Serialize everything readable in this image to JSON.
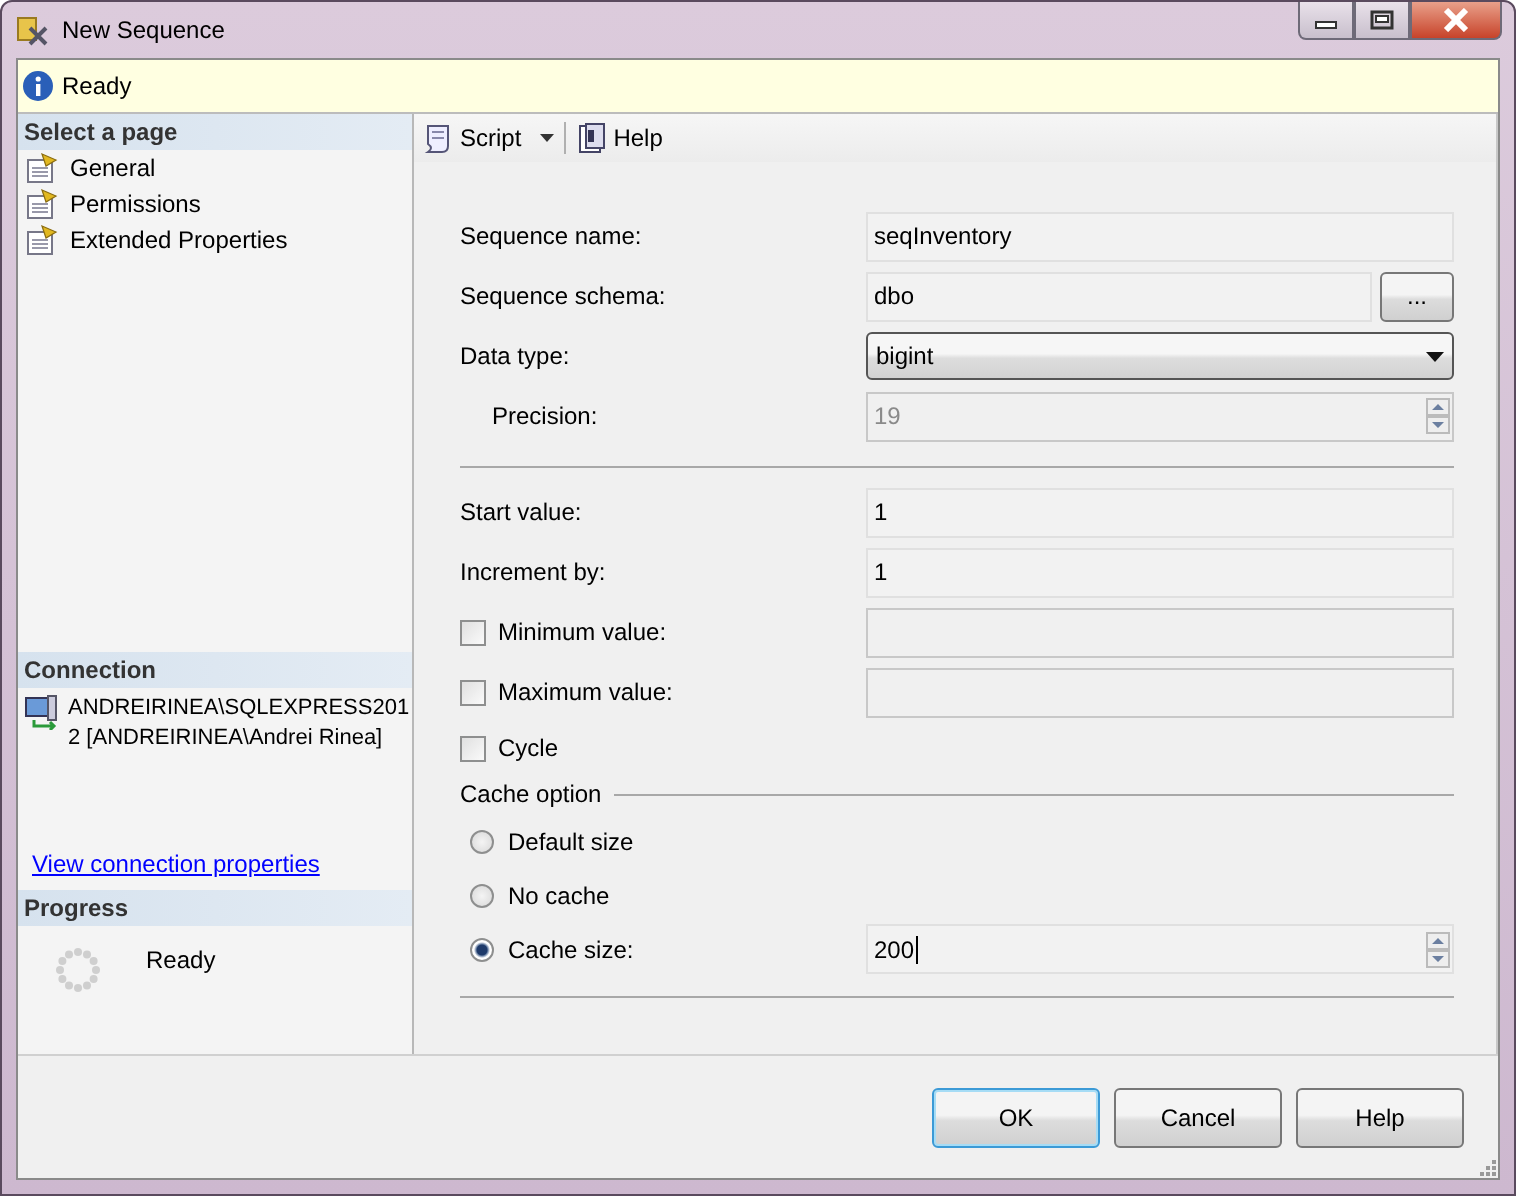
{
  "window": {
    "title": "New Sequence"
  },
  "info_bar": {
    "text": "Ready"
  },
  "sidebar": {
    "header": "Select a page",
    "items": [
      {
        "label": "General"
      },
      {
        "label": "Permissions"
      },
      {
        "label": "Extended Properties"
      }
    ]
  },
  "connection": {
    "header": "Connection",
    "server": "ANDREIRINEA\\SQLEXPRESS2012 [ANDREIRINEA\\Andrei Rinea]",
    "link": "View connection properties"
  },
  "progress": {
    "header": "Progress",
    "status": "Ready"
  },
  "toolbar": [
    {
      "kind": "dropdown",
      "label": "Script"
    },
    {
      "kind": "button",
      "label": "Help"
    }
  ],
  "general": [
    {
      "kind": "text",
      "label": "Sequence name:",
      "value": "seqInventory"
    },
    {
      "kind": "browse",
      "label": "Sequence schema:",
      "value": "dbo",
      "button": "..."
    },
    {
      "kind": "dropdown",
      "label": "Data type:",
      "value": "bigint"
    },
    {
      "kind": "sub_spinner",
      "label": "Precision:",
      "value": "19",
      "disabled": true
    }
  ],
  "values": [
    {
      "kind": "text",
      "label": "Start value:",
      "value": "1"
    },
    {
      "kind": "text",
      "label": "Increment by:",
      "value": "1"
    },
    {
      "kind": "checkbox_field",
      "label": "Minimum value:",
      "checked": false
    },
    {
      "kind": "checkbox_field",
      "label": "Maximum value:",
      "checked": false
    },
    {
      "kind": "checkbox",
      "label": "Cycle",
      "checked": false
    }
  ],
  "cache_option": {
    "title": "Cache option",
    "options": [
      {
        "label": "Default size",
        "selected": false
      },
      {
        "label": "No cache",
        "selected": false
      },
      {
        "label": "Cache size:",
        "selected": true,
        "value": "200"
      }
    ]
  },
  "buttons": [
    {
      "label": "OK",
      "focused": true
    },
    {
      "label": "Cancel",
      "focused": false
    },
    {
      "label": "Help",
      "focused": false
    }
  ]
}
